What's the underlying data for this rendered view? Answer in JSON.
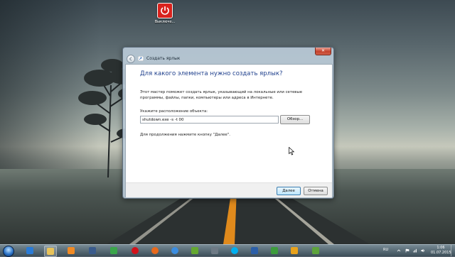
{
  "desktop": {
    "icon_label": "Выключе..."
  },
  "window": {
    "title": "Создать ярлык",
    "close_symbol": "✕",
    "heading": "Для какого элемента нужно создать ярлык?",
    "description": "Этот мастер поможет создать ярлык, указывающий на локальные или сетевые программы, файлы, папки, компьютеры или адреса в Интернете.",
    "location_label": "Укажите расположение объекта:",
    "location_value": "shutdown.exe -s -t 00",
    "browse_label": "Обзор...",
    "continue_hint": "Для продолжения нажмите кнопку \"Далее\".",
    "next_label": "Далее",
    "cancel_label": "Отмена"
  },
  "taskbar": {
    "items": [
      {
        "icon": "internet-explorer-icon",
        "color": "#2a7bd6"
      },
      {
        "icon": "file-explorer-icon",
        "color": "#e8c35a"
      },
      {
        "icon": "media-player-icon",
        "color": "#f08a24"
      },
      {
        "icon": "ship-app-icon",
        "color": "#3a5b8c"
      },
      {
        "icon": "green-app-icon",
        "color": "#3aa54a"
      },
      {
        "icon": "opera-icon",
        "color": "#d3121a"
      },
      {
        "icon": "firefox-icon",
        "color": "#e8691c"
      },
      {
        "icon": "chrome-icon",
        "color": "#3b8de0"
      },
      {
        "icon": "camtasia-icon",
        "color": "#64a830"
      },
      {
        "icon": "utility-icon",
        "color": "#6e7a85"
      },
      {
        "icon": "skype-icon",
        "color": "#00aff0"
      },
      {
        "icon": "media-icon",
        "color": "#2c5fa8"
      },
      {
        "icon": "camtasia-recorder-icon",
        "color": "#3d9c3c"
      },
      {
        "icon": "headset-icon",
        "color": "#e8a21c"
      },
      {
        "icon": "terminal-c-icon",
        "color": "#5da33c"
      }
    ],
    "language": "RU",
    "time": "1:06",
    "date": "01.07.2015"
  }
}
